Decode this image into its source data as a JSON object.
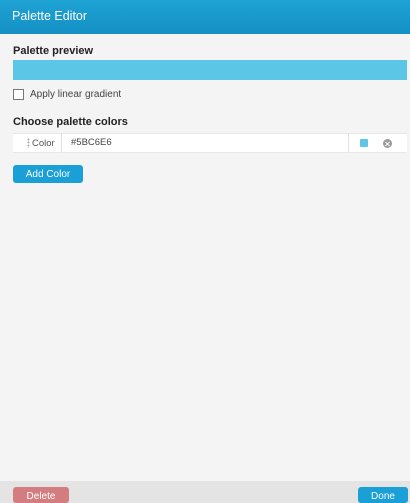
{
  "window": {
    "title": "Palette Editor"
  },
  "preview": {
    "label": "Palette preview",
    "color": "#5BC6E6"
  },
  "gradient": {
    "label": "Apply linear gradient",
    "checked": false
  },
  "colors_section": {
    "label": "Choose palette colors",
    "items": [
      {
        "label": "Color",
        "value": "#5BC6E6",
        "swatch": "#5BC6E6"
      }
    ],
    "add_label": "Add Color"
  },
  "footer": {
    "delete_label": "Delete",
    "done_label": "Done"
  },
  "theme": {
    "accent": "#1A9FD6",
    "danger": "#D47D80"
  }
}
